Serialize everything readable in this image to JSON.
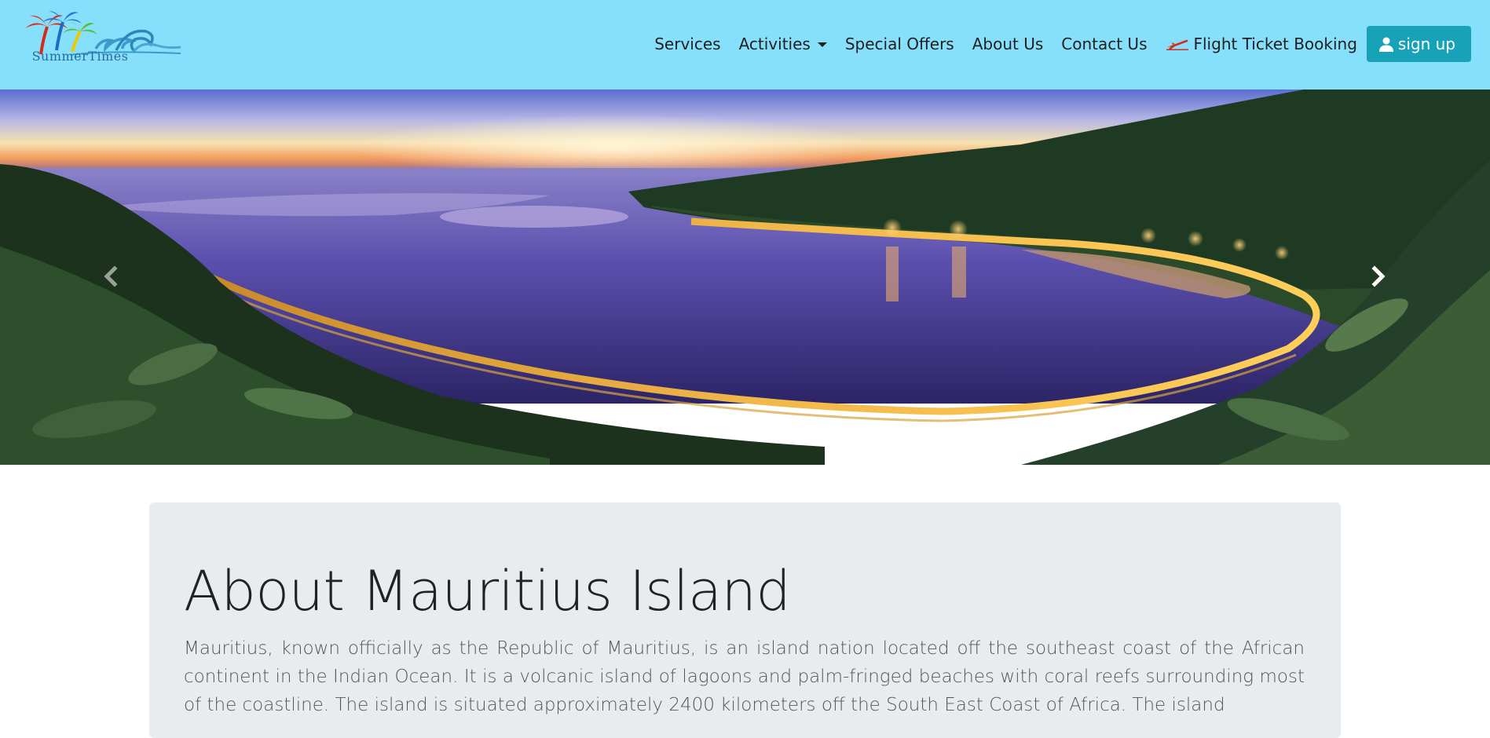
{
  "brand": {
    "name": "SummerTimes",
    "logo_icon": "palm-trees-waves-logo"
  },
  "nav": {
    "items": [
      {
        "label": "Services"
      },
      {
        "label": "Activities",
        "has_dropdown": true
      },
      {
        "label": "Special Offers"
      },
      {
        "label": "About Us"
      },
      {
        "label": "Contact Us"
      },
      {
        "label": "Flight Ticket Booking",
        "icon": "airplane-takeoff-icon"
      }
    ],
    "signup_label": "sign up",
    "signup_icon": "user-icon"
  },
  "carousel": {
    "image_subject": "Coastal bay road at dusk with lagoon",
    "prev_icon": "chevron-left-icon",
    "next_icon": "chevron-right-icon"
  },
  "about": {
    "title": "About Mauritius Island",
    "body": "Mauritius, known officially as the Republic of Mauritius, is an island nation located off the southeast coast of the African continent in the Indian Ocean. It is a volcanic island of lagoons and palm-fringed beaches with coral reefs surrounding most of the coastline. The island is situated approximately 2400 kilometers off the South East Coast of Africa. The island"
  },
  "colors": {
    "navbar_bg": "#87e0fb",
    "signup_bg": "#17a2b8",
    "jumbotron_bg": "#e9ecef"
  }
}
